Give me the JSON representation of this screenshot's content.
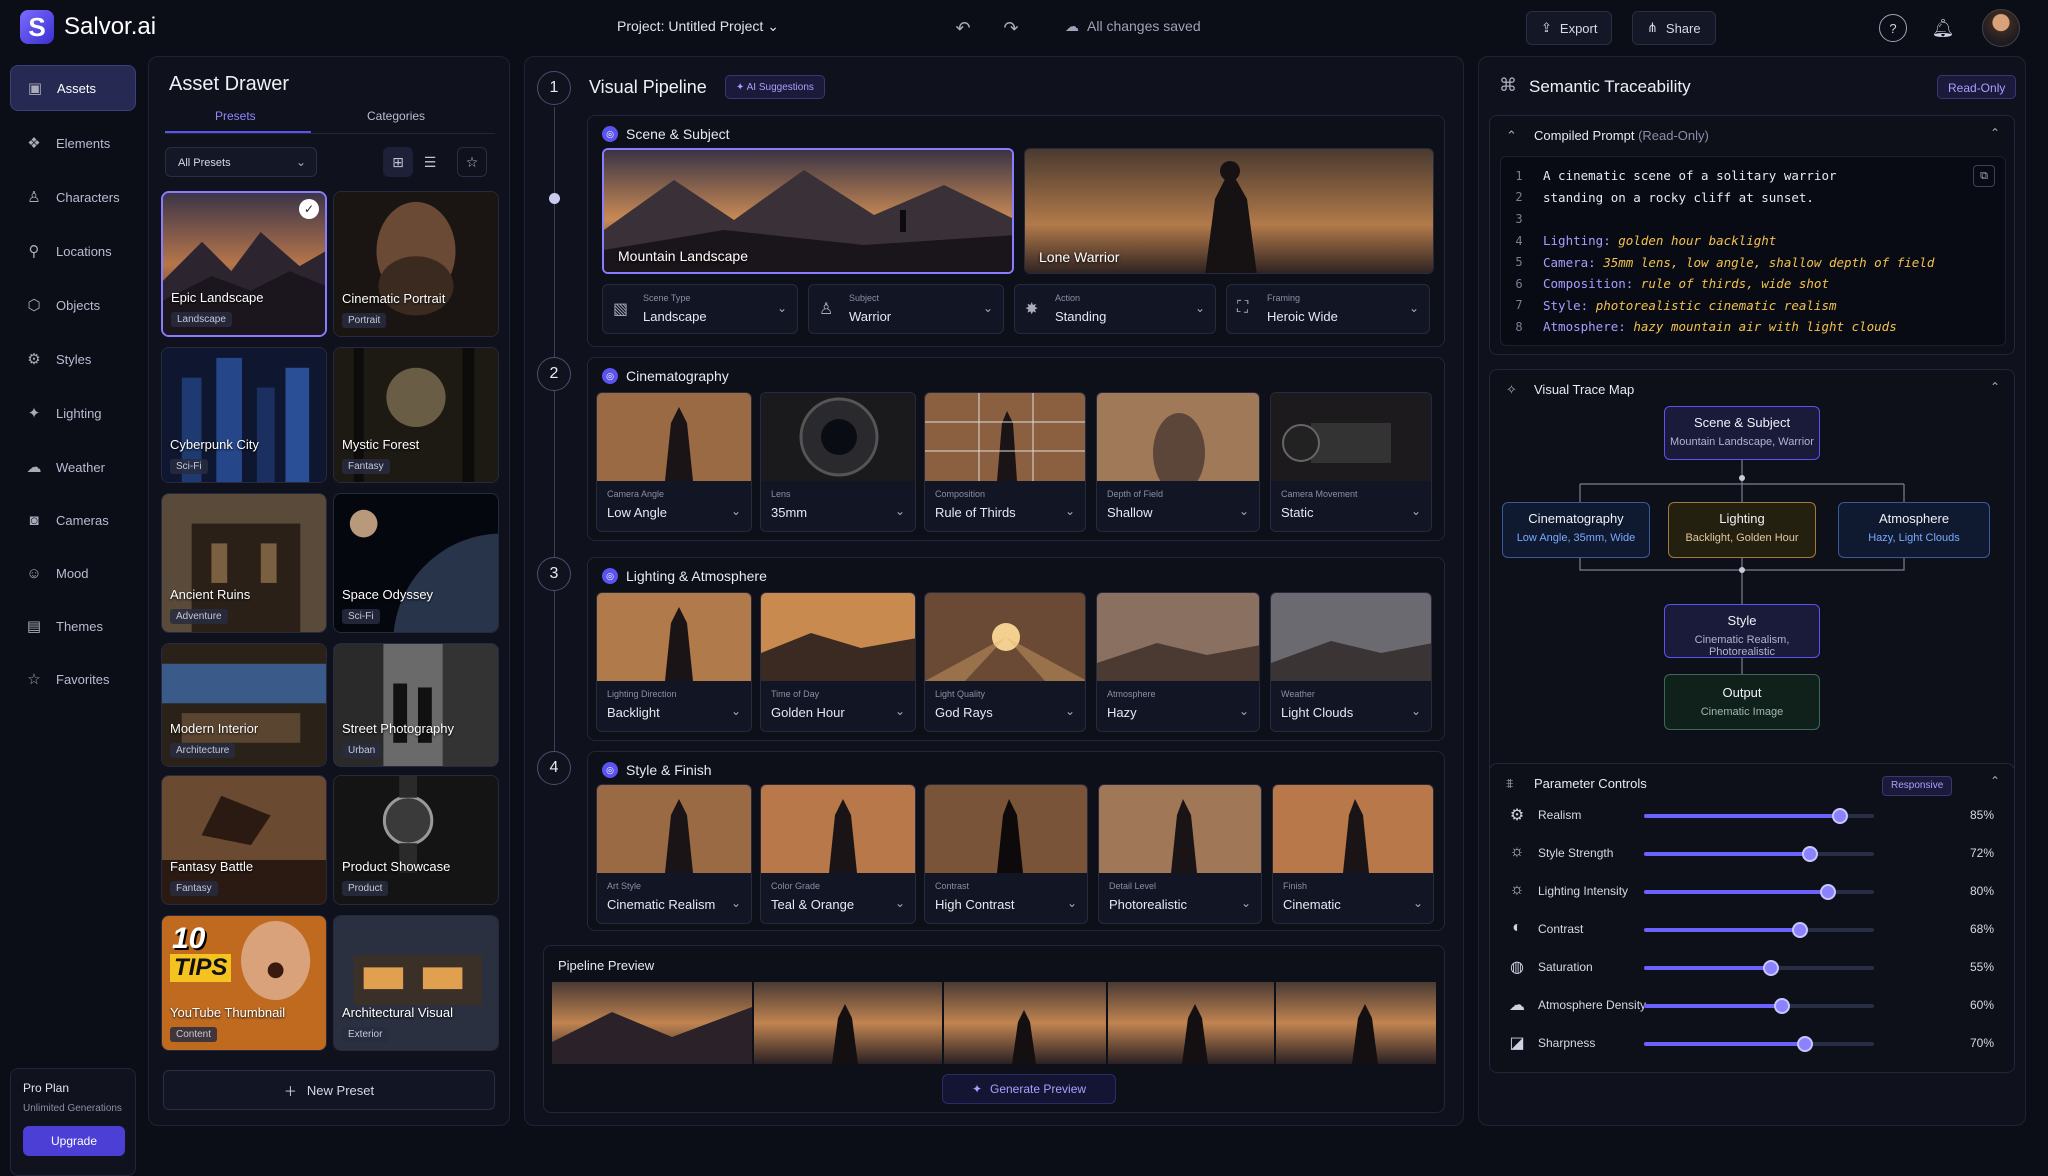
{
  "app": {
    "logo_letter": "S",
    "name": "Salvor.ai",
    "project": "Project: Untitled Project",
    "saved": "All changes saved",
    "export": "Export",
    "share": "Share"
  },
  "nav": {
    "items": [
      "Assets",
      "Elements",
      "Characters",
      "Locations",
      "Objects",
      "Styles",
      "Lighting",
      "Weather",
      "Cameras",
      "Mood",
      "Themes",
      "Favorites"
    ],
    "plan_title": "Pro Plan",
    "plan_sub": "Unlimited Generations",
    "upgrade": "Upgrade"
  },
  "drawer": {
    "title": "Asset Drawer",
    "tab_presets": "Presets",
    "tab_categories": "Categories",
    "filter": "All Presets",
    "new_preset": "New Preset",
    "cards": [
      {
        "name": "Epic Landscape",
        "tag": "Landscape"
      },
      {
        "name": "Cinematic Portrait",
        "tag": "Portrait"
      },
      {
        "name": "Cyberpunk City",
        "tag": "Sci-Fi"
      },
      {
        "name": "Mystic Forest",
        "tag": "Fantasy"
      },
      {
        "name": "Ancient Ruins",
        "tag": "Adventure"
      },
      {
        "name": "Space Odyssey",
        "tag": "Sci-Fi"
      },
      {
        "name": "Modern Interior",
        "tag": "Architecture"
      },
      {
        "name": "Street Photography",
        "tag": "Urban"
      },
      {
        "name": "Fantasy Battle",
        "tag": "Fantasy"
      },
      {
        "name": "Product Showcase",
        "tag": "Product"
      },
      {
        "name": "YouTube Thumbnail",
        "tag": "Content"
      },
      {
        "name": "Architectural Visual",
        "tag": "Exterior"
      }
    ],
    "thumb_text_1": "10",
    "thumb_text_2": "TIPS"
  },
  "pipeline": {
    "title": "Visual Pipeline",
    "ai": "AI Suggestions",
    "steps": [
      "1",
      "2",
      "3",
      "4"
    ],
    "scene": {
      "title": "Scene & Subject",
      "shot1": "Mountain Landscape",
      "shot2": "Lone Warrior",
      "dropdowns": [
        {
          "k": "Scene Type",
          "v": "Landscape"
        },
        {
          "k": "Subject",
          "v": "Warrior"
        },
        {
          "k": "Action",
          "v": "Standing"
        },
        {
          "k": "Framing",
          "v": "Heroic Wide"
        }
      ]
    },
    "cine": {
      "title": "Cinematography",
      "tiles": [
        {
          "k": "Camera Angle",
          "v": "Low Angle"
        },
        {
          "k": "Lens",
          "v": "35mm"
        },
        {
          "k": "Composition",
          "v": "Rule of Thirds"
        },
        {
          "k": "Depth of Field",
          "v": "Shallow"
        },
        {
          "k": "Camera Movement",
          "v": "Static"
        }
      ]
    },
    "light": {
      "title": "Lighting & Atmosphere",
      "tiles": [
        {
          "k": "Lighting Direction",
          "v": "Backlight"
        },
        {
          "k": "Time of Day",
          "v": "Golden Hour"
        },
        {
          "k": "Light Quality",
          "v": "God Rays"
        },
        {
          "k": "Atmosphere",
          "v": "Hazy"
        },
        {
          "k": "Weather",
          "v": "Light Clouds"
        }
      ]
    },
    "style": {
      "title": "Style & Finish",
      "tiles": [
        {
          "k": "Art Style",
          "v": "Cinematic Realism"
        },
        {
          "k": "Color Grade",
          "v": "Teal & Orange"
        },
        {
          "k": "Contrast",
          "v": "High Contrast"
        },
        {
          "k": "Detail Level",
          "v": "Photorealistic"
        },
        {
          "k": "Finish",
          "v": "Cinematic"
        }
      ]
    },
    "preview_title": "Pipeline Preview",
    "generate": "Generate Preview"
  },
  "trace": {
    "title": "Semantic Traceability",
    "readonly": "Read-Only",
    "compiled": "Compiled Prompt",
    "compiled_note": "(Read-Only)",
    "lines": [
      {
        "n": "1",
        "t": "A cinematic scene of a solitary warrior"
      },
      {
        "n": "2",
        "t": "standing on a rocky cliff at sunset."
      },
      {
        "n": "3",
        "t": ""
      },
      {
        "n": "4",
        "k": "Lighting:",
        "y": "golden hour backlight"
      },
      {
        "n": "5",
        "k": "Camera:",
        "y": "35mm lens, low angle, shallow depth of field"
      },
      {
        "n": "6",
        "k": "Composition:",
        "y": "rule of thirds, wide shot"
      },
      {
        "n": "7",
        "k": "Style:",
        "y": "photorealistic cinematic realism"
      },
      {
        "n": "8",
        "k": "Atmosphere:",
        "y": "hazy mountain air with light clouds"
      }
    ],
    "map_title": "Visual Trace Map",
    "nodes": {
      "scene": {
        "a": "Scene & Subject",
        "b": "Mountain Landscape, Warrior"
      },
      "cine": {
        "a": "Cinematography",
        "b": "Low Angle, 35mm, Wide"
      },
      "light": {
        "a": "Lighting",
        "b": "Backlight, Golden Hour"
      },
      "atmo": {
        "a": "Atmosphere",
        "b": "Hazy, Light Clouds"
      },
      "style": {
        "a": "Style",
        "b": "Cinematic Realism, Photorealistic"
      },
      "output": {
        "a": "Output",
        "b": "Cinematic Image"
      }
    },
    "params_title": "Parameter Controls",
    "responsive": "Responsive",
    "params": [
      {
        "label": "Realism",
        "value": 85,
        "text": "85%"
      },
      {
        "label": "Style Strength",
        "value": 72,
        "text": "72%"
      },
      {
        "label": "Lighting Intensity",
        "value": 80,
        "text": "80%"
      },
      {
        "label": "Contrast",
        "value": 68,
        "text": "68%"
      },
      {
        "label": "Saturation",
        "value": 55,
        "text": "55%"
      },
      {
        "label": "Atmosphere Density",
        "value": 60,
        "text": "60%"
      },
      {
        "label": "Sharpness",
        "value": 70,
        "text": "70%"
      }
    ]
  }
}
